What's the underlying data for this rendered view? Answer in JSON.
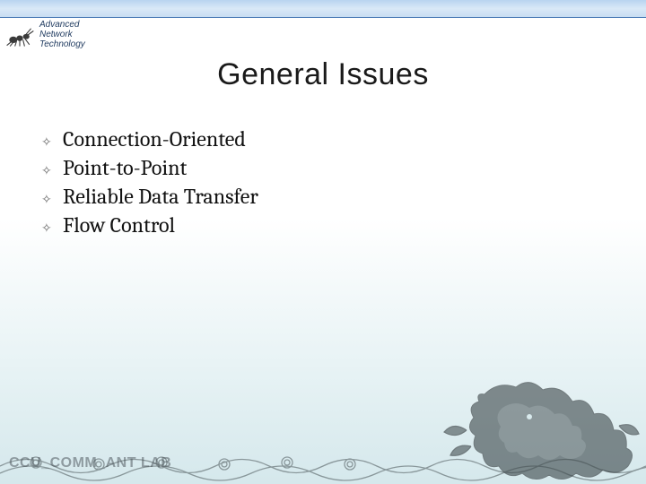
{
  "logo": {
    "line1": "Advanced",
    "line2": "Network",
    "line3": "Technology"
  },
  "title": "General Issues",
  "bullets": [
    "Connection-Oriented",
    "Point-to-Point",
    "Reliable Data Transfer",
    "Flow Control"
  ],
  "footer": "CCU_COMM_ANT LAB"
}
